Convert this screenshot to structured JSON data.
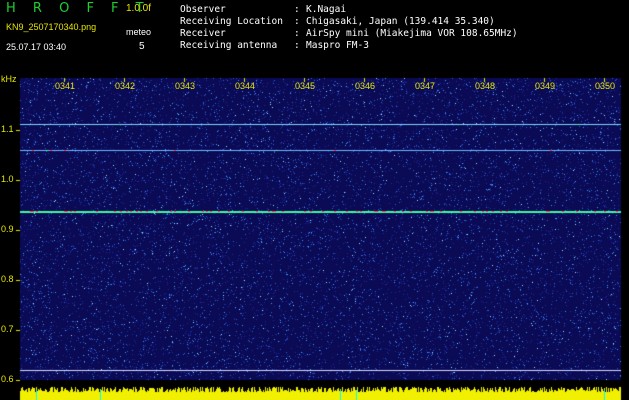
{
  "header": {
    "app_title": "H R O F F T",
    "version": "1.0.0f",
    "filename": "KN9_2507170340.png",
    "meteo_label": "meteo",
    "datetime": "25.07.17 03:40",
    "meteo_count": "5",
    "info": [
      {
        "key": "Observer",
        "sep": ":",
        "value": "K.Nagai"
      },
      {
        "key": "Receiving Location",
        "sep": ":",
        "value": "Chigasaki, Japan (139.414 35.340)"
      },
      {
        "key": "Receiver",
        "sep": ":",
        "value": "AirSpy mini (Miakejima VOR 108.65MHz)"
      },
      {
        "key": "Receiving antenna",
        "sep": ":",
        "value": "Maspro FM-3"
      }
    ]
  },
  "spectrogram": {
    "y_unit": "kHz",
    "y_ticks": [
      "1.1",
      "1.0",
      "0.9",
      "0.8",
      "0.7",
      "0.6"
    ],
    "x_ticks": [
      "0341",
      "0342",
      "0343",
      "0344",
      "0345",
      "0346",
      "0347",
      "0348",
      "0349",
      "0350"
    ],
    "colors": {
      "background": "#0a0a55",
      "label": "#e6e600",
      "baseline": "#f0f000"
    }
  }
}
